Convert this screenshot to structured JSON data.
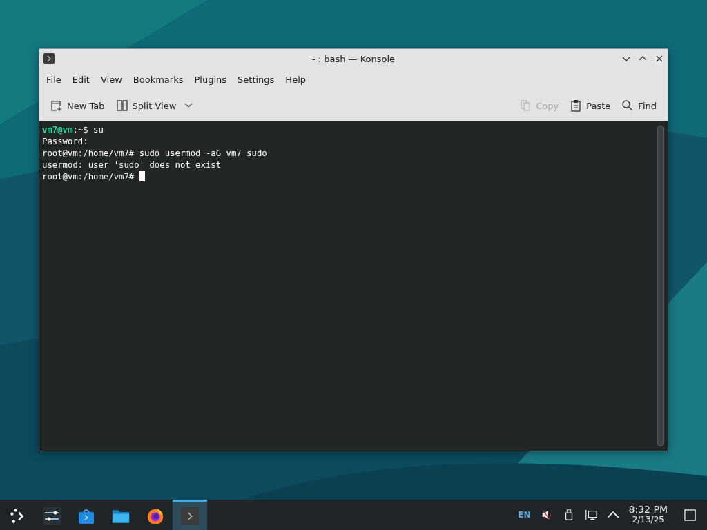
{
  "window": {
    "title": "- : bash — Konsole"
  },
  "menu": [
    "File",
    "Edit",
    "View",
    "Bookmarks",
    "Plugins",
    "Settings",
    "Help"
  ],
  "toolbar": [
    {
      "label": "New Tab",
      "kind": "new-tab",
      "disabled": false
    },
    {
      "label": "Split View",
      "kind": "split",
      "disabled": false
    },
    {
      "label": "Copy",
      "kind": "copy",
      "disabled": true
    },
    {
      "label": "Paste",
      "kind": "paste",
      "disabled": false
    },
    {
      "label": "Find",
      "kind": "find",
      "disabled": false
    }
  ],
  "terminal": {
    "lines": [
      [
        {
          "text": "vm7@vm",
          "kind": "user"
        },
        {
          "text": ":~$ su",
          "kind": "plain"
        }
      ],
      [
        {
          "text": "Password:",
          "kind": "plain"
        }
      ],
      [
        {
          "text": "root@vm:/home/vm7# sudo usermod -aG vm7 sudo",
          "kind": "plain"
        }
      ],
      [
        {
          "text": "usermod: user 'sudo' does not exist",
          "kind": "plain"
        }
      ],
      [
        {
          "text": "root@vm:/home/vm7# ",
          "kind": "plain"
        }
      ]
    ],
    "cursor": true
  },
  "taskbar": {
    "apps": [
      {
        "kind": "launcher",
        "selected": false
      },
      {
        "kind": "settings",
        "selected": false
      },
      {
        "kind": "store",
        "selected": false
      },
      {
        "kind": "files",
        "selected": false
      },
      {
        "kind": "browser",
        "selected": false
      },
      {
        "kind": "terminal",
        "selected": true
      }
    ],
    "language": "EN",
    "time": "8:32 PM",
    "date": "2/13/25"
  }
}
